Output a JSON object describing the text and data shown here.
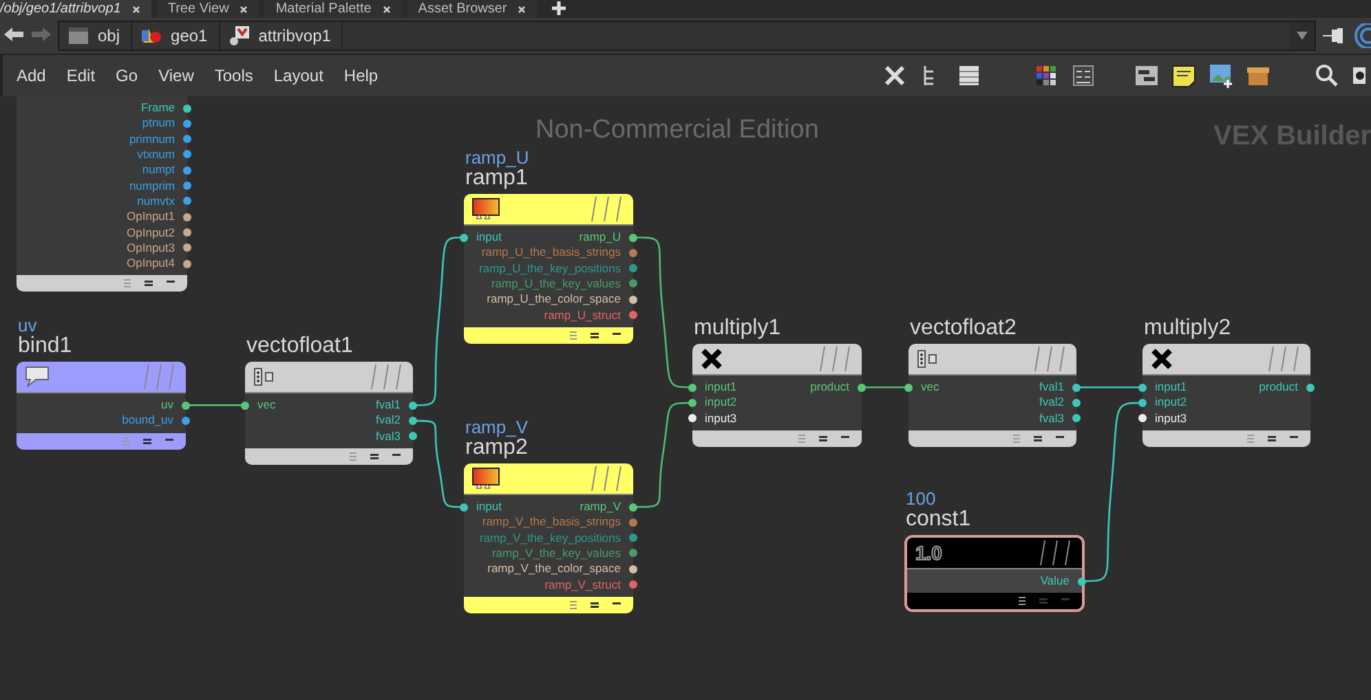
{
  "tabs": [
    {
      "label": "/obj/geo1/attribvop1",
      "selected": true
    },
    {
      "label": "Tree View",
      "selected": false
    },
    {
      "label": "Material Palette",
      "selected": false
    },
    {
      "label": "Asset Browser",
      "selected": false
    }
  ],
  "path": [
    {
      "label": "obj",
      "kind": "network"
    },
    {
      "label": "geo1",
      "kind": "geometry"
    },
    {
      "label": "attribvop1",
      "kind": "vop"
    }
  ],
  "menu": [
    "Add",
    "Edit",
    "Go",
    "View",
    "Tools",
    "Layout",
    "Help"
  ],
  "canvas": {
    "watermark": "Non-Commercial Edition",
    "context": "VEX Builder"
  },
  "nodes": [
    {
      "kind": "globals",
      "color": "#cfcfcf",
      "outputs": [
        {
          "label": "Frame",
          "color": "#3ec7b8"
        },
        {
          "label": "ptnum",
          "color": "#3aa0e8"
        },
        {
          "label": "primnum",
          "color": "#3aa0e8"
        },
        {
          "label": "vtxnum",
          "color": "#3aa0e8"
        },
        {
          "label": "numpt",
          "color": "#3aa0e8"
        },
        {
          "label": "numprim",
          "color": "#3aa0e8"
        },
        {
          "label": "numvtx",
          "color": "#3aa0e8"
        },
        {
          "label": "OpInput1",
          "color": "#c8a88a"
        },
        {
          "label": "OpInput2",
          "color": "#c8a88a"
        },
        {
          "label": "OpInput3",
          "color": "#c8a88a"
        },
        {
          "label": "OpInput4",
          "color": "#c8a88a"
        }
      ]
    },
    {
      "kind": "bind",
      "subtitle": "uv",
      "name": "bind1",
      "color": "#9c9cff",
      "outputs": [
        {
          "label": "uv",
          "color": "#58c878"
        },
        {
          "label": "bound_uv",
          "color": "#3aa0e8"
        }
      ]
    },
    {
      "kind": "vectofloat",
      "name": "vectofloat1",
      "color": "#cfcfcf",
      "inputs": [
        {
          "label": "vec",
          "color": "#58c878"
        }
      ],
      "outputs": [
        {
          "label": "fval1",
          "color": "#3ec7b8"
        },
        {
          "label": "fval2",
          "color": "#3ec7b8"
        },
        {
          "label": "fval3",
          "color": "#3ec7b8"
        }
      ]
    },
    {
      "kind": "ramp",
      "subtitle": "ramp_U",
      "name": "ramp1",
      "color": "#ffff66",
      "inputs": [
        {
          "label": "input",
          "color": "#3ec7b8"
        }
      ],
      "outputs": [
        {
          "label": "ramp_U",
          "color": "#58c878"
        },
        {
          "label": "ramp_U_the_basis_strings",
          "color": "#b87a4a"
        },
        {
          "label": "ramp_U_the_key_positions",
          "color": "#2a9a8a"
        },
        {
          "label": "ramp_U_the_key_values",
          "color": "#4a9a6a"
        },
        {
          "label": "ramp_U_the_color_space",
          "color": "#d6bea6"
        },
        {
          "label": "ramp_U_struct",
          "color": "#e06464"
        }
      ]
    },
    {
      "kind": "ramp",
      "subtitle": "ramp_V",
      "name": "ramp2",
      "color": "#ffff66",
      "inputs": [
        {
          "label": "input",
          "color": "#3ec7b8"
        }
      ],
      "outputs": [
        {
          "label": "ramp_V",
          "color": "#58c878"
        },
        {
          "label": "ramp_V_the_basis_strings",
          "color": "#b87a4a"
        },
        {
          "label": "ramp_V_the_key_positions",
          "color": "#2a9a8a"
        },
        {
          "label": "ramp_V_the_key_values",
          "color": "#4a9a6a"
        },
        {
          "label": "ramp_V_the_color_space",
          "color": "#d6bea6"
        },
        {
          "label": "ramp_V_struct",
          "color": "#e06464"
        }
      ]
    },
    {
      "kind": "multiply",
      "name": "multiply1",
      "color": "#cfcfcf",
      "inputs": [
        {
          "label": "input1",
          "color": "#58c878"
        },
        {
          "label": "input2",
          "color": "#58c878"
        },
        {
          "label": "input3",
          "color": "#eeeeee"
        }
      ],
      "outputs": [
        {
          "label": "product",
          "color": "#58c878"
        }
      ]
    },
    {
      "kind": "vectofloat",
      "name": "vectofloat2",
      "color": "#cfcfcf",
      "inputs": [
        {
          "label": "vec",
          "color": "#58c878"
        }
      ],
      "outputs": [
        {
          "label": "fval1",
          "color": "#3ec7b8"
        },
        {
          "label": "fval2",
          "color": "#3ec7b8"
        },
        {
          "label": "fval3",
          "color": "#3ec7b8"
        }
      ]
    },
    {
      "kind": "multiply",
      "name": "multiply2",
      "color": "#cfcfcf",
      "inputs": [
        {
          "label": "input1",
          "color": "#3ec7b8"
        },
        {
          "label": "input2",
          "color": "#3ec7b8"
        },
        {
          "label": "input3",
          "color": "#eeeeee"
        }
      ],
      "outputs": [
        {
          "label": "product",
          "color": "#3ec7b8"
        }
      ]
    },
    {
      "kind": "const",
      "subtitle": "100",
      "name": "const1",
      "color": "#d89a9a",
      "value": "1.0",
      "outputs": [
        {
          "label": "Value",
          "color": "#3ec7b8"
        }
      ]
    }
  ]
}
